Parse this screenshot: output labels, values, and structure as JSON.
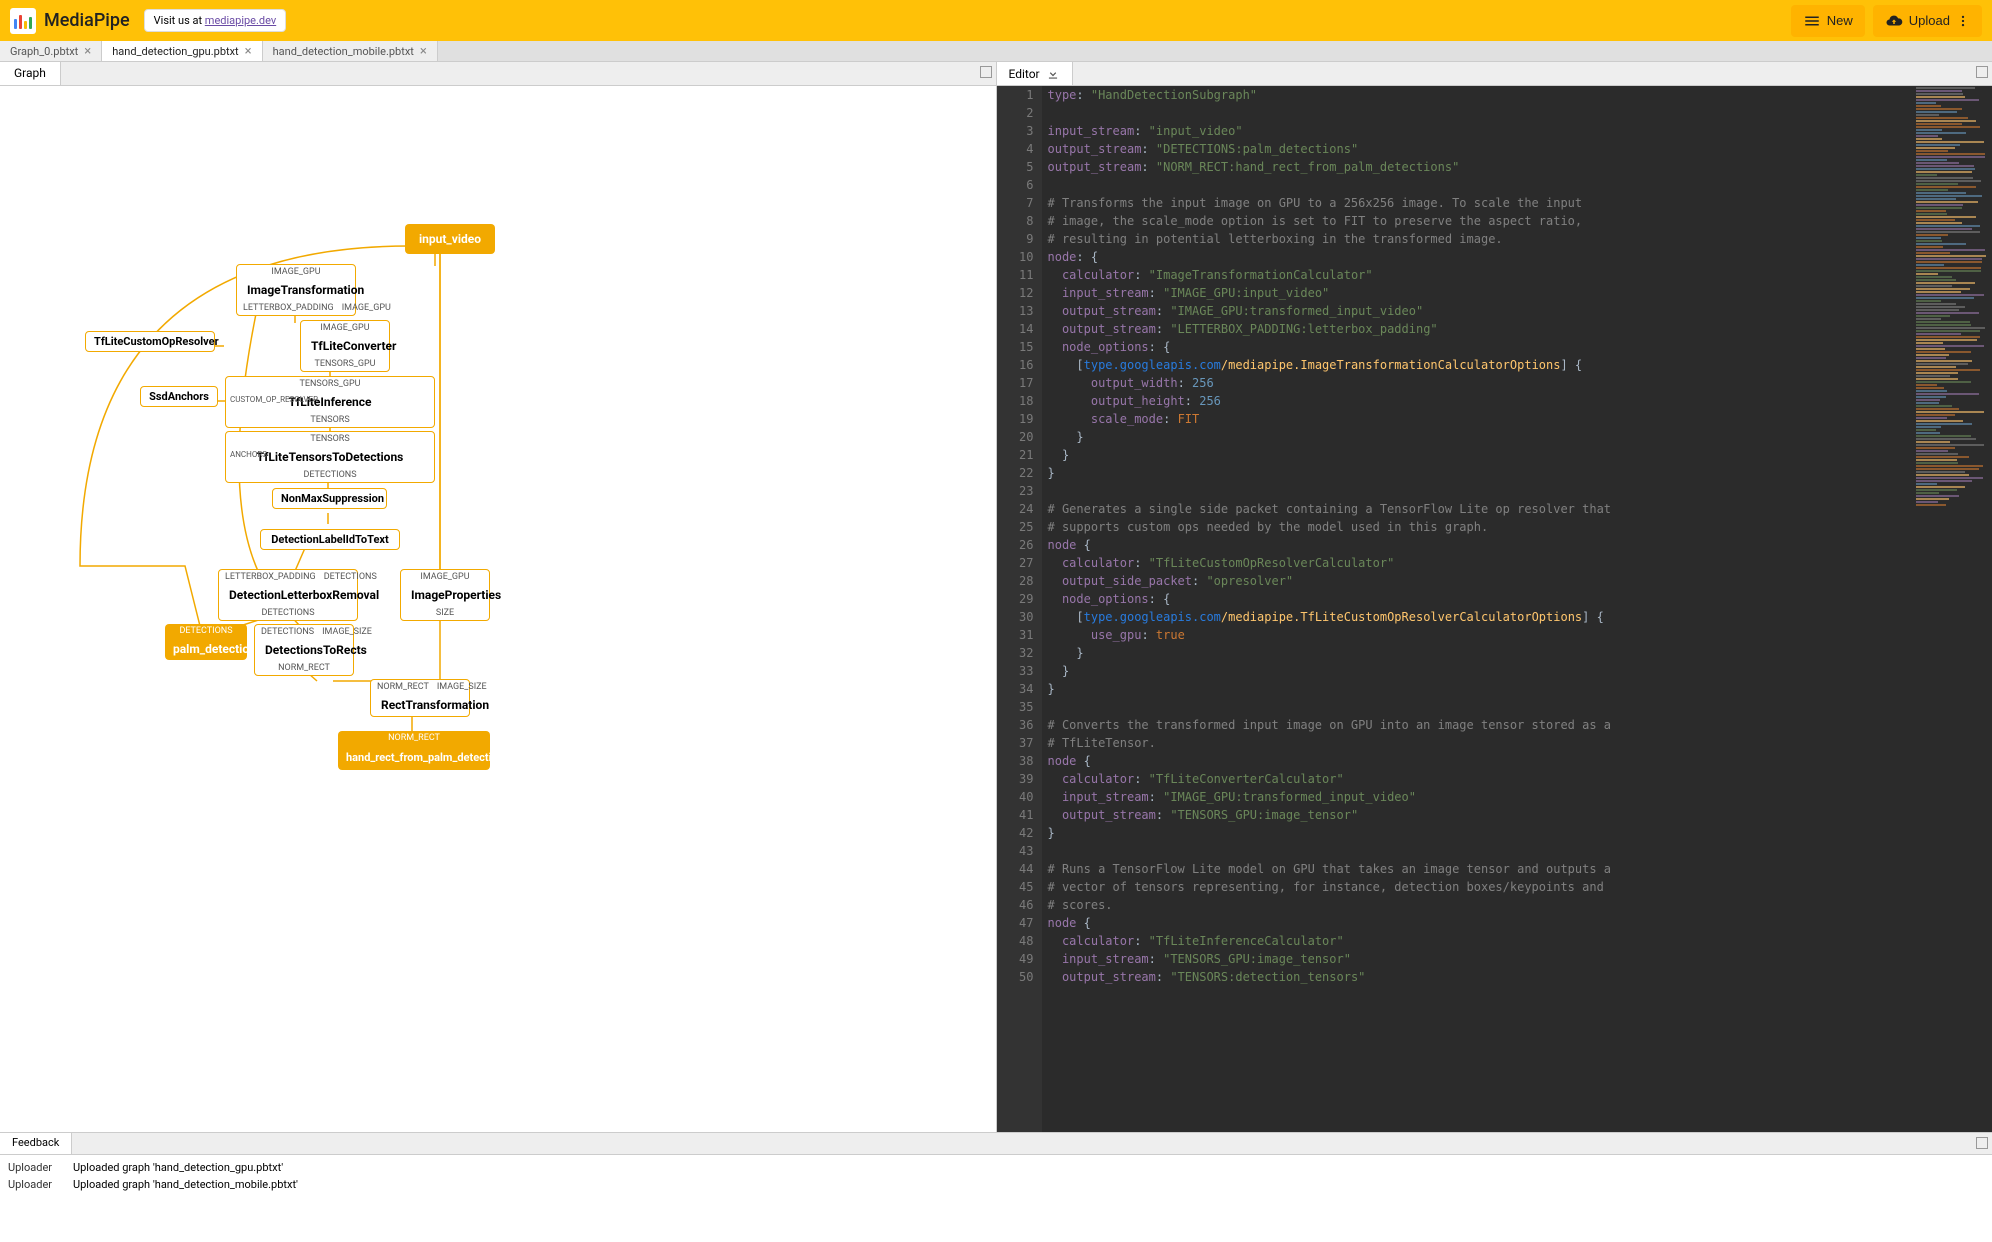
{
  "header": {
    "title": "MediaPipe",
    "visit_prefix": "Visit us at ",
    "visit_link": "mediapipe.dev",
    "new_btn": "New",
    "upload_btn": "Upload"
  },
  "file_tabs": [
    {
      "label": "Graph_0.pbtxt",
      "active": false
    },
    {
      "label": "hand_detection_gpu.pbtxt",
      "active": true
    },
    {
      "label": "hand_detection_mobile.pbtxt",
      "active": false
    }
  ],
  "left_tab": "Graph",
  "right_tab": "Editor",
  "graph": {
    "input_video": "input_video",
    "img_transform": {
      "title": "ImageTransformation",
      "top": "IMAGE_GPU",
      "bot_l": "LETTERBOX_PADDING",
      "bot_r": "IMAGE_GPU"
    },
    "tflite_resolver": {
      "title": "TfLiteCustomOpResolver"
    },
    "tflite_converter": {
      "title": "TfLiteConverter",
      "top": "IMAGE_GPU",
      "bot": "TENSORS_GPU"
    },
    "ssd_anchors": {
      "title": "SsdAnchors"
    },
    "tflite_inference": {
      "title": "TfLiteInference",
      "top": "TENSORS_GPU",
      "side": "CUSTOM_OP_RESOLVER",
      "bot": "TENSORS"
    },
    "tensors_to_det": {
      "title": "TfLiteTensorsToDetections",
      "top": "TENSORS",
      "side": "ANCHORS",
      "bot": "DETECTIONS"
    },
    "nms": {
      "title": "NonMaxSuppression"
    },
    "label_to_text": {
      "title": "DetectionLabelIdToText"
    },
    "letterbox_removal": {
      "title": "DetectionLetterboxRemoval",
      "top_l": "LETTERBOX_PADDING",
      "top_r": "DETECTIONS",
      "bot": "DETECTIONS"
    },
    "img_props": {
      "title": "ImageProperties",
      "top": "IMAGE_GPU",
      "bot": "SIZE"
    },
    "palm_det": {
      "title": "palm_detections",
      "top": "DETECTIONS"
    },
    "det_to_rects": {
      "title": "DetectionsToRects",
      "top_l": "DETECTIONS",
      "top_r": "IMAGE_SIZE",
      "bot": "NORM_RECT"
    },
    "rect_transform": {
      "title": "RectTransformation",
      "top_l": "NORM_RECT",
      "top_r": "IMAGE_SIZE"
    },
    "hand_rect": {
      "title": "hand_rect_from_palm_detections",
      "top": "NORM_RECT"
    }
  },
  "code": [
    {
      "n": 1,
      "t": [
        [
          "key",
          "type"
        ],
        [
          "punct",
          ": "
        ],
        [
          "str",
          "\"HandDetectionSubgraph\""
        ]
      ]
    },
    {
      "n": 2,
      "t": []
    },
    {
      "n": 3,
      "t": [
        [
          "key",
          "input_stream"
        ],
        [
          "punct",
          ": "
        ],
        [
          "str",
          "\"input_video\""
        ]
      ]
    },
    {
      "n": 4,
      "t": [
        [
          "key",
          "output_stream"
        ],
        [
          "punct",
          ": "
        ],
        [
          "str",
          "\"DETECTIONS:palm_detections\""
        ]
      ]
    },
    {
      "n": 5,
      "t": [
        [
          "key",
          "output_stream"
        ],
        [
          "punct",
          ": "
        ],
        [
          "str",
          "\"NORM_RECT:hand_rect_from_palm_detections\""
        ]
      ]
    },
    {
      "n": 6,
      "t": []
    },
    {
      "n": 7,
      "t": [
        [
          "com",
          "# Transforms the input image on GPU to a 256x256 image. To scale the input"
        ]
      ]
    },
    {
      "n": 8,
      "t": [
        [
          "com",
          "# image, the scale_mode option is set to FIT to preserve the aspect ratio,"
        ]
      ]
    },
    {
      "n": 9,
      "t": [
        [
          "com",
          "# resulting in potential letterboxing in the transformed image."
        ]
      ]
    },
    {
      "n": 10,
      "t": [
        [
          "key",
          "node"
        ],
        [
          "punct",
          ": {"
        ]
      ]
    },
    {
      "n": 11,
      "t": [
        [
          "punct",
          "  "
        ],
        [
          "key",
          "calculator"
        ],
        [
          "punct",
          ": "
        ],
        [
          "str",
          "\"ImageTransformationCalculator\""
        ]
      ]
    },
    {
      "n": 12,
      "t": [
        [
          "punct",
          "  "
        ],
        [
          "key",
          "input_stream"
        ],
        [
          "punct",
          ": "
        ],
        [
          "str",
          "\"IMAGE_GPU:input_video\""
        ]
      ]
    },
    {
      "n": 13,
      "t": [
        [
          "punct",
          "  "
        ],
        [
          "key",
          "output_stream"
        ],
        [
          "punct",
          ": "
        ],
        [
          "str",
          "\"IMAGE_GPU:transformed_input_video\""
        ]
      ]
    },
    {
      "n": 14,
      "t": [
        [
          "punct",
          "  "
        ],
        [
          "key",
          "output_stream"
        ],
        [
          "punct",
          ": "
        ],
        [
          "str",
          "\"LETTERBOX_PADDING:letterbox_padding\""
        ]
      ]
    },
    {
      "n": 15,
      "t": [
        [
          "punct",
          "  "
        ],
        [
          "key",
          "node_options"
        ],
        [
          "punct",
          ": {"
        ]
      ]
    },
    {
      "n": 16,
      "t": [
        [
          "punct",
          "    ["
        ],
        [
          "link",
          "type.googleapis.com"
        ],
        [
          "type",
          "/mediapipe.ImageTransformationCalculatorOptions"
        ],
        [
          "punct",
          "] {"
        ]
      ]
    },
    {
      "n": 17,
      "t": [
        [
          "punct",
          "      "
        ],
        [
          "key",
          "output_width"
        ],
        [
          "punct",
          ": "
        ],
        [
          "num",
          "256"
        ]
      ]
    },
    {
      "n": 18,
      "t": [
        [
          "punct",
          "      "
        ],
        [
          "key",
          "output_height"
        ],
        [
          "punct",
          ": "
        ],
        [
          "num",
          "256"
        ]
      ]
    },
    {
      "n": 19,
      "t": [
        [
          "punct",
          "      "
        ],
        [
          "key",
          "scale_mode"
        ],
        [
          "punct",
          ": "
        ],
        [
          "const",
          "FIT"
        ]
      ]
    },
    {
      "n": 20,
      "t": [
        [
          "punct",
          "    }"
        ]
      ]
    },
    {
      "n": 21,
      "t": [
        [
          "punct",
          "  }"
        ]
      ]
    },
    {
      "n": 22,
      "t": [
        [
          "punct",
          "}"
        ]
      ]
    },
    {
      "n": 23,
      "t": []
    },
    {
      "n": 24,
      "t": [
        [
          "com",
          "# Generates a single side packet containing a TensorFlow Lite op resolver that"
        ]
      ]
    },
    {
      "n": 25,
      "t": [
        [
          "com",
          "# supports custom ops needed by the model used in this graph."
        ]
      ]
    },
    {
      "n": 26,
      "t": [
        [
          "key",
          "node"
        ],
        [
          "punct",
          " {"
        ]
      ]
    },
    {
      "n": 27,
      "t": [
        [
          "punct",
          "  "
        ],
        [
          "key",
          "calculator"
        ],
        [
          "punct",
          ": "
        ],
        [
          "str",
          "\"TfLiteCustomOpResolverCalculator\""
        ]
      ]
    },
    {
      "n": 28,
      "t": [
        [
          "punct",
          "  "
        ],
        [
          "key",
          "output_side_packet"
        ],
        [
          "punct",
          ": "
        ],
        [
          "str",
          "\"opresolver\""
        ]
      ]
    },
    {
      "n": 29,
      "t": [
        [
          "punct",
          "  "
        ],
        [
          "key",
          "node_options"
        ],
        [
          "punct",
          ": {"
        ]
      ]
    },
    {
      "n": 30,
      "t": [
        [
          "punct",
          "    ["
        ],
        [
          "link",
          "type.googleapis.com"
        ],
        [
          "type",
          "/mediapipe.TfLiteCustomOpResolverCalculatorOptions"
        ],
        [
          "punct",
          "] {"
        ]
      ]
    },
    {
      "n": 31,
      "t": [
        [
          "punct",
          "      "
        ],
        [
          "key",
          "use_gpu"
        ],
        [
          "punct",
          ": "
        ],
        [
          "const",
          "true"
        ]
      ]
    },
    {
      "n": 32,
      "t": [
        [
          "punct",
          "    }"
        ]
      ]
    },
    {
      "n": 33,
      "t": [
        [
          "punct",
          "  }"
        ]
      ]
    },
    {
      "n": 34,
      "t": [
        [
          "punct",
          "}"
        ]
      ]
    },
    {
      "n": 35,
      "t": []
    },
    {
      "n": 36,
      "t": [
        [
          "com",
          "# Converts the transformed input image on GPU into an image tensor stored as a"
        ]
      ]
    },
    {
      "n": 37,
      "t": [
        [
          "com",
          "# TfLiteTensor."
        ]
      ]
    },
    {
      "n": 38,
      "t": [
        [
          "key",
          "node"
        ],
        [
          "punct",
          " {"
        ]
      ]
    },
    {
      "n": 39,
      "t": [
        [
          "punct",
          "  "
        ],
        [
          "key",
          "calculator"
        ],
        [
          "punct",
          ": "
        ],
        [
          "str",
          "\"TfLiteConverterCalculator\""
        ]
      ]
    },
    {
      "n": 40,
      "t": [
        [
          "punct",
          "  "
        ],
        [
          "key",
          "input_stream"
        ],
        [
          "punct",
          ": "
        ],
        [
          "str",
          "\"IMAGE_GPU:transformed_input_video\""
        ]
      ]
    },
    {
      "n": 41,
      "t": [
        [
          "punct",
          "  "
        ],
        [
          "key",
          "output_stream"
        ],
        [
          "punct",
          ": "
        ],
        [
          "str",
          "\"TENSORS_GPU:image_tensor\""
        ]
      ]
    },
    {
      "n": 42,
      "t": [
        [
          "punct",
          "}"
        ]
      ]
    },
    {
      "n": 43,
      "t": []
    },
    {
      "n": 44,
      "t": [
        [
          "com",
          "# Runs a TensorFlow Lite model on GPU that takes an image tensor and outputs a"
        ]
      ]
    },
    {
      "n": 45,
      "t": [
        [
          "com",
          "# vector of tensors representing, for instance, detection boxes/keypoints and"
        ]
      ]
    },
    {
      "n": 46,
      "t": [
        [
          "com",
          "# scores."
        ]
      ]
    },
    {
      "n": 47,
      "t": [
        [
          "key",
          "node"
        ],
        [
          "punct",
          " {"
        ]
      ]
    },
    {
      "n": 48,
      "t": [
        [
          "punct",
          "  "
        ],
        [
          "key",
          "calculator"
        ],
        [
          "punct",
          ": "
        ],
        [
          "str",
          "\"TfLiteInferenceCalculator\""
        ]
      ]
    },
    {
      "n": 49,
      "t": [
        [
          "punct",
          "  "
        ],
        [
          "key",
          "input_stream"
        ],
        [
          "punct",
          ": "
        ],
        [
          "str",
          "\"TENSORS_GPU:image_tensor\""
        ]
      ]
    },
    {
      "n": 50,
      "t": [
        [
          "punct",
          "  "
        ],
        [
          "key",
          "output_stream"
        ],
        [
          "punct",
          ": "
        ],
        [
          "str",
          "\"TENSORS:detection_tensors\""
        ]
      ]
    }
  ],
  "feedback": {
    "tab": "Feedback",
    "rows": [
      {
        "src": "Uploader",
        "msg": "Uploaded graph 'hand_detection_gpu.pbtxt'"
      },
      {
        "src": "Uploader",
        "msg": "Uploaded graph 'hand_detection_mobile.pbtxt'"
      }
    ]
  }
}
